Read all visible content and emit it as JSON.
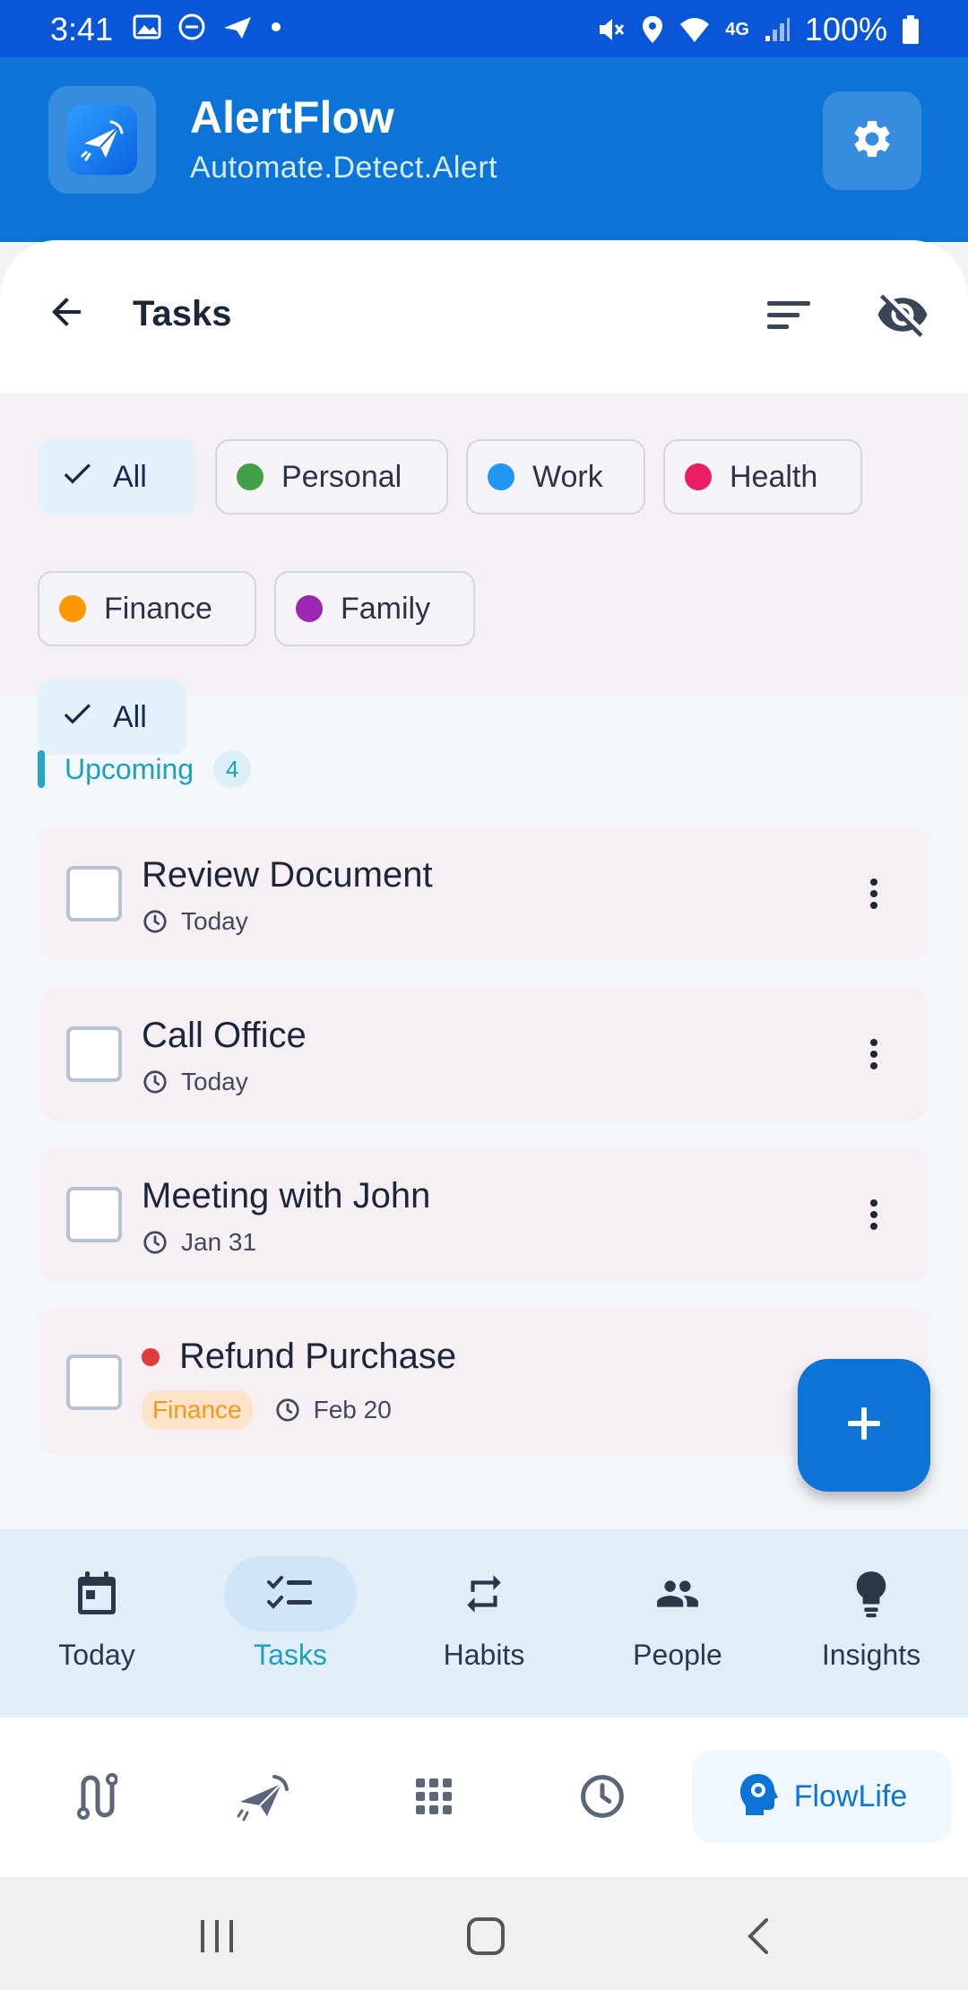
{
  "status_bar": {
    "time": "3:41",
    "battery": "100%",
    "network": "4G"
  },
  "app": {
    "title": "AlertFlow",
    "subtitle": "Automate.Detect.Alert"
  },
  "page": {
    "title": "Tasks"
  },
  "filters": [
    {
      "label": "All",
      "selected": true
    },
    {
      "label": "Personal",
      "color": "#43a047"
    },
    {
      "label": "Work",
      "color": "#2196f3"
    },
    {
      "label": "Health",
      "color": "#e91e63"
    },
    {
      "label": "Finance",
      "color": "#ff9800"
    },
    {
      "label": "Family",
      "color": "#9c27b0"
    }
  ],
  "section": {
    "title": "Upcoming",
    "count": "4"
  },
  "tasks": [
    {
      "title": "Review Document",
      "due": "Today"
    },
    {
      "title": "Call Office",
      "due": "Today"
    },
    {
      "title": "Meeting with John",
      "due": "Jan 31"
    },
    {
      "title": "Refund Purchase",
      "due": "Feb 20",
      "category": "Finance",
      "priority_color": "#e23b3b"
    }
  ],
  "bottom_nav": [
    {
      "label": "Today",
      "icon": "calendar-icon"
    },
    {
      "label": "Tasks",
      "icon": "checklist-icon",
      "active": true
    },
    {
      "label": "Habits",
      "icon": "repeat-icon"
    },
    {
      "label": "People",
      "icon": "people-icon"
    },
    {
      "label": "Insights",
      "icon": "lightbulb-icon"
    }
  ],
  "toolbar": {
    "items": [
      "route-icon",
      "send-icon",
      "grid-icon",
      "clock-icon"
    ],
    "flowlife_label": "FlowLife"
  },
  "colors": {
    "status_bar": "#0a56d8",
    "header": "#0c74d6",
    "accent": "#1aa1be",
    "fab": "#0c74d6"
  }
}
